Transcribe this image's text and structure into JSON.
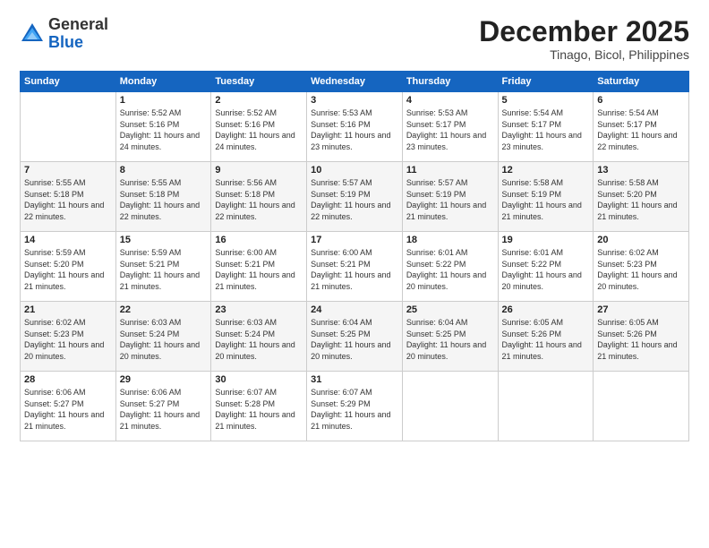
{
  "logo": {
    "general": "General",
    "blue": "Blue"
  },
  "header": {
    "month": "December 2025",
    "location": "Tinago, Bicol, Philippines"
  },
  "weekdays": [
    "Sunday",
    "Monday",
    "Tuesday",
    "Wednesday",
    "Thursday",
    "Friday",
    "Saturday"
  ],
  "weeks": [
    [
      {
        "day": "",
        "sunrise": "",
        "sunset": "",
        "daylight": ""
      },
      {
        "day": "1",
        "sunrise": "Sunrise: 5:52 AM",
        "sunset": "Sunset: 5:16 PM",
        "daylight": "Daylight: 11 hours and 24 minutes."
      },
      {
        "day": "2",
        "sunrise": "Sunrise: 5:52 AM",
        "sunset": "Sunset: 5:16 PM",
        "daylight": "Daylight: 11 hours and 24 minutes."
      },
      {
        "day": "3",
        "sunrise": "Sunrise: 5:53 AM",
        "sunset": "Sunset: 5:16 PM",
        "daylight": "Daylight: 11 hours and 23 minutes."
      },
      {
        "day": "4",
        "sunrise": "Sunrise: 5:53 AM",
        "sunset": "Sunset: 5:17 PM",
        "daylight": "Daylight: 11 hours and 23 minutes."
      },
      {
        "day": "5",
        "sunrise": "Sunrise: 5:54 AM",
        "sunset": "Sunset: 5:17 PM",
        "daylight": "Daylight: 11 hours and 23 minutes."
      },
      {
        "day": "6",
        "sunrise": "Sunrise: 5:54 AM",
        "sunset": "Sunset: 5:17 PM",
        "daylight": "Daylight: 11 hours and 22 minutes."
      }
    ],
    [
      {
        "day": "7",
        "sunrise": "Sunrise: 5:55 AM",
        "sunset": "Sunset: 5:18 PM",
        "daylight": "Daylight: 11 hours and 22 minutes."
      },
      {
        "day": "8",
        "sunrise": "Sunrise: 5:55 AM",
        "sunset": "Sunset: 5:18 PM",
        "daylight": "Daylight: 11 hours and 22 minutes."
      },
      {
        "day": "9",
        "sunrise": "Sunrise: 5:56 AM",
        "sunset": "Sunset: 5:18 PM",
        "daylight": "Daylight: 11 hours and 22 minutes."
      },
      {
        "day": "10",
        "sunrise": "Sunrise: 5:57 AM",
        "sunset": "Sunset: 5:19 PM",
        "daylight": "Daylight: 11 hours and 22 minutes."
      },
      {
        "day": "11",
        "sunrise": "Sunrise: 5:57 AM",
        "sunset": "Sunset: 5:19 PM",
        "daylight": "Daylight: 11 hours and 21 minutes."
      },
      {
        "day": "12",
        "sunrise": "Sunrise: 5:58 AM",
        "sunset": "Sunset: 5:19 PM",
        "daylight": "Daylight: 11 hours and 21 minutes."
      },
      {
        "day": "13",
        "sunrise": "Sunrise: 5:58 AM",
        "sunset": "Sunset: 5:20 PM",
        "daylight": "Daylight: 11 hours and 21 minutes."
      }
    ],
    [
      {
        "day": "14",
        "sunrise": "Sunrise: 5:59 AM",
        "sunset": "Sunset: 5:20 PM",
        "daylight": "Daylight: 11 hours and 21 minutes."
      },
      {
        "day": "15",
        "sunrise": "Sunrise: 5:59 AM",
        "sunset": "Sunset: 5:21 PM",
        "daylight": "Daylight: 11 hours and 21 minutes."
      },
      {
        "day": "16",
        "sunrise": "Sunrise: 6:00 AM",
        "sunset": "Sunset: 5:21 PM",
        "daylight": "Daylight: 11 hours and 21 minutes."
      },
      {
        "day": "17",
        "sunrise": "Sunrise: 6:00 AM",
        "sunset": "Sunset: 5:21 PM",
        "daylight": "Daylight: 11 hours and 21 minutes."
      },
      {
        "day": "18",
        "sunrise": "Sunrise: 6:01 AM",
        "sunset": "Sunset: 5:22 PM",
        "daylight": "Daylight: 11 hours and 20 minutes."
      },
      {
        "day": "19",
        "sunrise": "Sunrise: 6:01 AM",
        "sunset": "Sunset: 5:22 PM",
        "daylight": "Daylight: 11 hours and 20 minutes."
      },
      {
        "day": "20",
        "sunrise": "Sunrise: 6:02 AM",
        "sunset": "Sunset: 5:23 PM",
        "daylight": "Daylight: 11 hours and 20 minutes."
      }
    ],
    [
      {
        "day": "21",
        "sunrise": "Sunrise: 6:02 AM",
        "sunset": "Sunset: 5:23 PM",
        "daylight": "Daylight: 11 hours and 20 minutes."
      },
      {
        "day": "22",
        "sunrise": "Sunrise: 6:03 AM",
        "sunset": "Sunset: 5:24 PM",
        "daylight": "Daylight: 11 hours and 20 minutes."
      },
      {
        "day": "23",
        "sunrise": "Sunrise: 6:03 AM",
        "sunset": "Sunset: 5:24 PM",
        "daylight": "Daylight: 11 hours and 20 minutes."
      },
      {
        "day": "24",
        "sunrise": "Sunrise: 6:04 AM",
        "sunset": "Sunset: 5:25 PM",
        "daylight": "Daylight: 11 hours and 20 minutes."
      },
      {
        "day": "25",
        "sunrise": "Sunrise: 6:04 AM",
        "sunset": "Sunset: 5:25 PM",
        "daylight": "Daylight: 11 hours and 20 minutes."
      },
      {
        "day": "26",
        "sunrise": "Sunrise: 6:05 AM",
        "sunset": "Sunset: 5:26 PM",
        "daylight": "Daylight: 11 hours and 21 minutes."
      },
      {
        "day": "27",
        "sunrise": "Sunrise: 6:05 AM",
        "sunset": "Sunset: 5:26 PM",
        "daylight": "Daylight: 11 hours and 21 minutes."
      }
    ],
    [
      {
        "day": "28",
        "sunrise": "Sunrise: 6:06 AM",
        "sunset": "Sunset: 5:27 PM",
        "daylight": "Daylight: 11 hours and 21 minutes."
      },
      {
        "day": "29",
        "sunrise": "Sunrise: 6:06 AM",
        "sunset": "Sunset: 5:27 PM",
        "daylight": "Daylight: 11 hours and 21 minutes."
      },
      {
        "day": "30",
        "sunrise": "Sunrise: 6:07 AM",
        "sunset": "Sunset: 5:28 PM",
        "daylight": "Daylight: 11 hours and 21 minutes."
      },
      {
        "day": "31",
        "sunrise": "Sunrise: 6:07 AM",
        "sunset": "Sunset: 5:29 PM",
        "daylight": "Daylight: 11 hours and 21 minutes."
      },
      {
        "day": "",
        "sunrise": "",
        "sunset": "",
        "daylight": ""
      },
      {
        "day": "",
        "sunrise": "",
        "sunset": "",
        "daylight": ""
      },
      {
        "day": "",
        "sunrise": "",
        "sunset": "",
        "daylight": ""
      }
    ]
  ]
}
